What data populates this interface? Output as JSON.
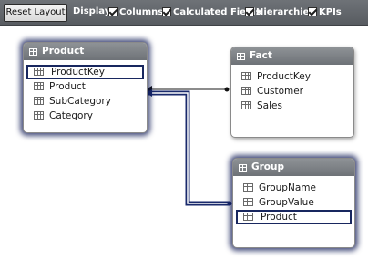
{
  "toolbar": {
    "reset_label": "Reset Layout",
    "display_label": "Display:",
    "options": [
      {
        "label": "Columns",
        "checked": true
      },
      {
        "label": "Calculated Fields",
        "checked": true
      },
      {
        "label": "Hierarchies",
        "checked": true
      },
      {
        "label": "KPIs",
        "checked": true
      }
    ]
  },
  "tables": {
    "product": {
      "title": "Product",
      "columns": [
        "ProductKey",
        "Product",
        "SubCategory",
        "Category"
      ],
      "highlighted": "ProductKey"
    },
    "fact": {
      "title": "Fact",
      "columns": [
        "ProductKey",
        "Customer",
        "Sales"
      ]
    },
    "group": {
      "title": "Group",
      "columns": [
        "GroupName",
        "GroupValue",
        "Product"
      ],
      "highlighted": "Product"
    }
  },
  "colors": {
    "toolbar": "#62666b",
    "header": "#7e8287",
    "selection": "#18275f",
    "relationship": "#1a2a6c"
  }
}
